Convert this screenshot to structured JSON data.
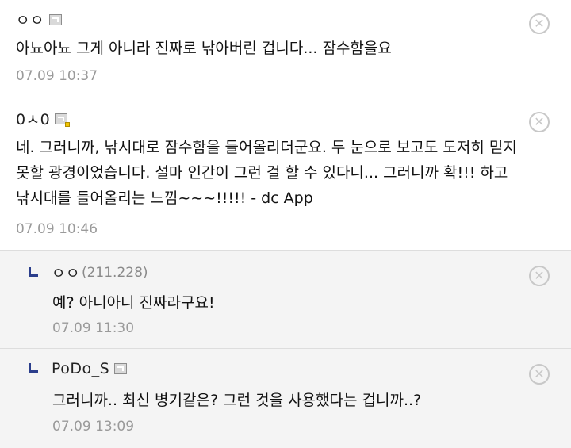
{
  "comments": [
    {
      "nick": "ㅇㅇ",
      "ip": "",
      "icon": "gallery-icon",
      "text": "아뇨아뇨 그게 아니라 진짜로 낚아버린 겁니다... 잠수함을요",
      "time": "07.09 10:37",
      "delete_icon": "ⓧ"
    },
    {
      "nick": "0ㅅ0",
      "ip": "",
      "icon": "sub-gallery-icon",
      "text": "네. 그러니까, 낚시대로 잠수함을 들어올리더군요. 두 눈으로 보고도 도저히 믿지 못할 광경이었습니다. 설마 인간이 그런 걸 할 수 있다니... 그러니까 확!!! 하고 낚시대를 들어올리는 느낌~~~!!!!! - dc App",
      "time": "07.09 10:46",
      "delete_icon": "ⓧ"
    },
    {
      "nick": "ㅇㅇ",
      "ip": "(211.228)",
      "icon": "",
      "text": "예? 아니아니 진짜라구요!",
      "time": "07.09 11:30",
      "delete_icon": "ⓧ"
    },
    {
      "nick": "PoDo_S",
      "ip": "",
      "icon": "gallery-icon",
      "text": "그러니까.. 최신 병기같은? 그런 것을 사용했다는 겁니까..?",
      "time": "07.09 13:09",
      "delete_icon": "ⓧ"
    }
  ]
}
